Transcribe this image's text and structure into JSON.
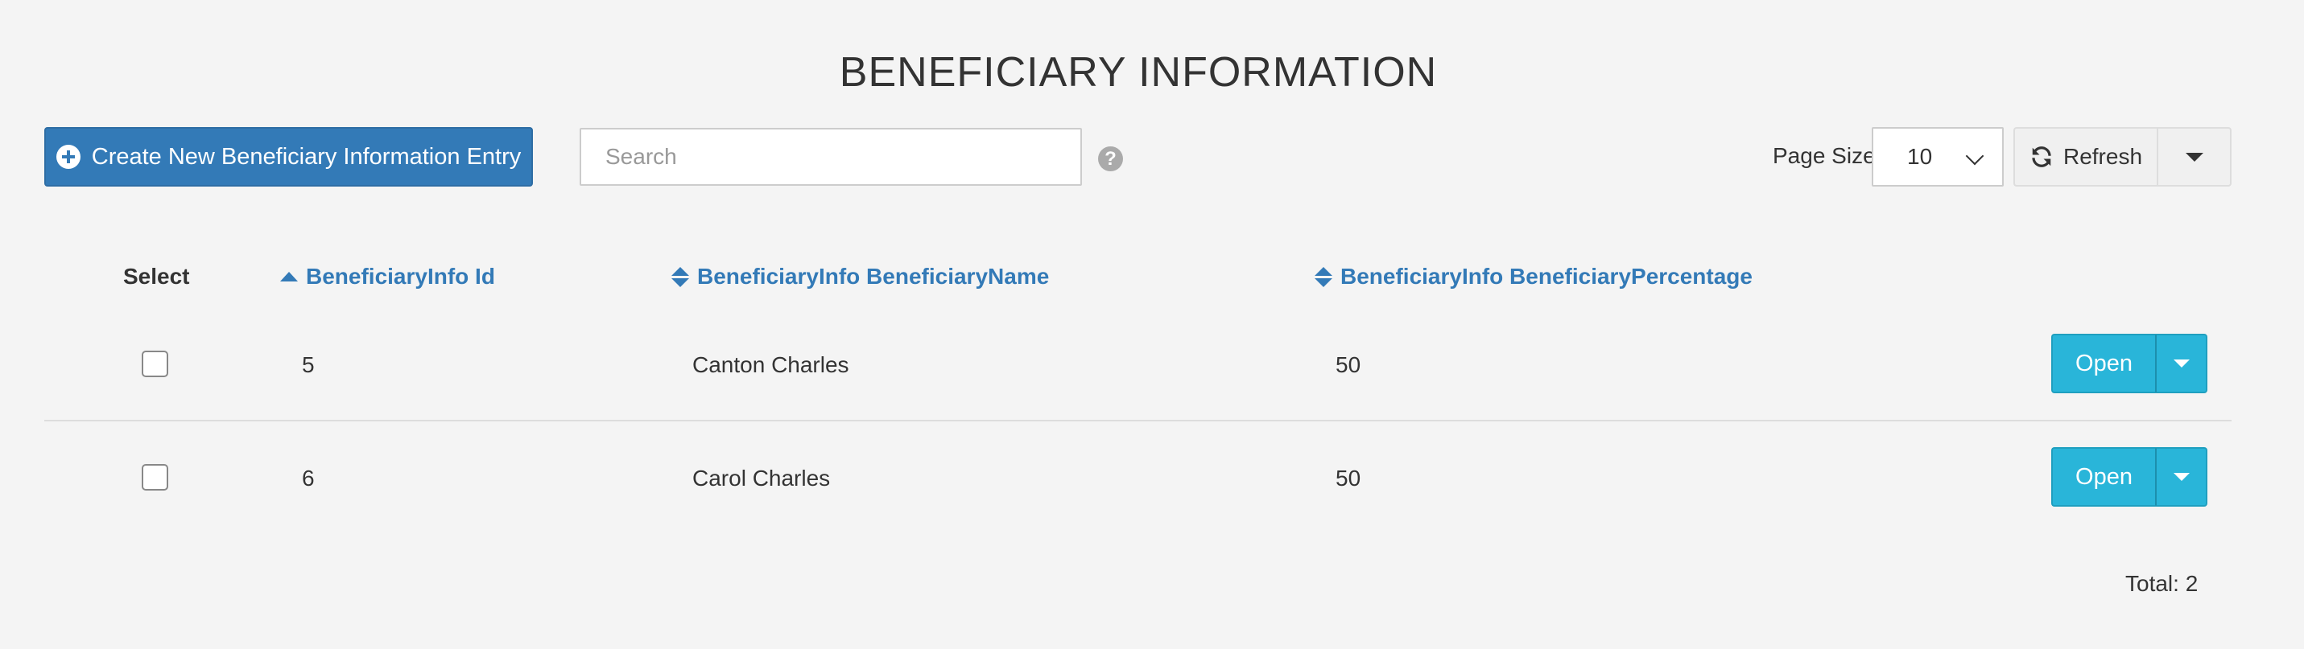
{
  "page": {
    "title": "BENEFICIARY INFORMATION"
  },
  "toolbar": {
    "create_label": "Create New Beneficiary Information Entry",
    "search_placeholder": "Search",
    "search_value": "",
    "help_glyph": "?",
    "page_size_label": "Page Size",
    "page_size_value": "10",
    "refresh_label": "Refresh"
  },
  "table": {
    "columns": {
      "select": "Select",
      "id": "BeneficiaryInfo Id",
      "name": "BeneficiaryInfo BeneficiaryName",
      "percentage": "BeneficiaryInfo BeneficiaryPercentage"
    },
    "sort": {
      "column": "id",
      "direction": "asc"
    },
    "rows": [
      {
        "id": "5",
        "name": "Canton Charles",
        "percentage": "50",
        "action": "Open",
        "checked": false
      },
      {
        "id": "6",
        "name": "Carol Charles",
        "percentage": "50",
        "action": "Open",
        "checked": false
      }
    ],
    "total": "Total: 2"
  },
  "colors": {
    "primary": "#337ab7",
    "info": "#29b5d9",
    "background": "#f4f4f4"
  },
  "icons": {
    "create": "plus-circle-icon",
    "help": "question-circle-icon",
    "refresh": "refresh-icon",
    "sort_asc": "sort-asc-icon",
    "sort_both": "sort-icon",
    "dropdown": "caret-down-icon"
  }
}
